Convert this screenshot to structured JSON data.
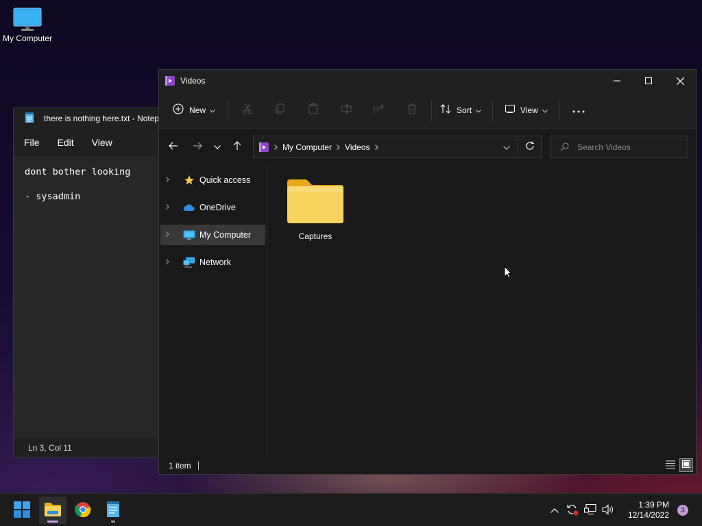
{
  "desktop": {
    "icon_label": "My Computer"
  },
  "notepad": {
    "title": "there is nothing here.txt - Notepad",
    "menu": [
      "File",
      "Edit",
      "View"
    ],
    "lines": [
      "dont bother looking",
      "",
      "- sysadmin"
    ],
    "status": "Ln 3, Col 11"
  },
  "explorer": {
    "title": "Videos",
    "toolbar": {
      "new_label": "New",
      "sort_label": "Sort",
      "view_label": "View"
    },
    "breadcrumb": [
      "My Computer",
      "Videos"
    ],
    "search_placeholder": "Search Videos",
    "sidebar": [
      {
        "label": "Quick access",
        "icon": "star-icon"
      },
      {
        "label": "OneDrive",
        "icon": "cloud-icon"
      },
      {
        "label": "My Computer",
        "icon": "computer-icon",
        "selected": true
      },
      {
        "label": "Network",
        "icon": "network-icon"
      }
    ],
    "items": [
      {
        "label": "Captures",
        "type": "folder"
      }
    ],
    "status": "1 item"
  },
  "taskbar": {
    "apps": [
      "start",
      "file-explorer",
      "chrome",
      "notepad"
    ],
    "time": "1:39 PM",
    "date": "12/14/2022",
    "notifications": "3"
  },
  "colors": {
    "accent": "#c79ad9",
    "folder": "#f7cf5a",
    "window_bg": "#191919"
  }
}
